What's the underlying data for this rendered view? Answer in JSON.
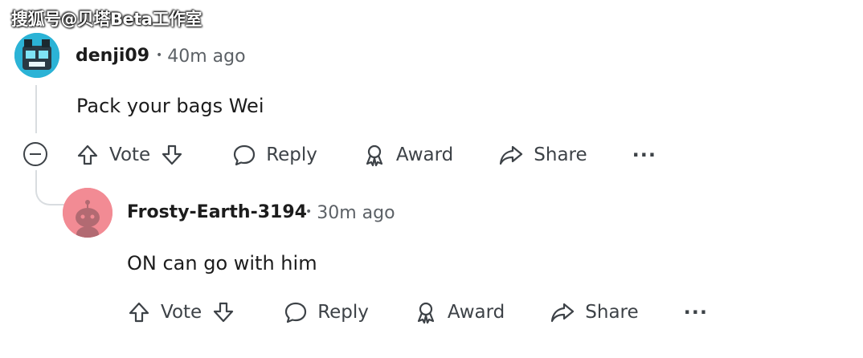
{
  "watermark": "搜狐号@贝塔Beta工作室",
  "comments": [
    {
      "username": "denji09",
      "time": "40m ago",
      "text": "Pack your bags Wei",
      "actions": {
        "vote": "Vote",
        "reply": "Reply",
        "award": "Award",
        "share": "Share",
        "more": "···"
      }
    },
    {
      "username": "Frosty-Earth-3194",
      "time": "30m ago",
      "text": "ON can go with him",
      "actions": {
        "vote": "Vote",
        "reply": "Reply",
        "award": "Award",
        "share": "Share",
        "more": "···"
      }
    }
  ],
  "separator": "•",
  "colors": {
    "avatar1": "#20a8c8",
    "avatar2": "#f28b94",
    "text": "#1c1c1c",
    "muted": "#5c6166"
  }
}
